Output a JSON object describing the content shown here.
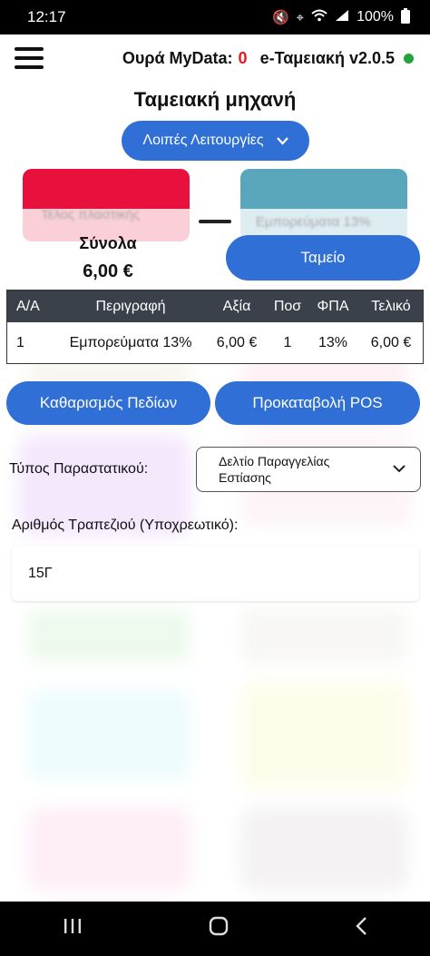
{
  "status": {
    "time": "12:17",
    "battery": "100%",
    "icons": [
      "mute-icon",
      "location-icon",
      "wifi-icon",
      "signal-icon",
      "battery-icon"
    ]
  },
  "header": {
    "queue_label": "Ουρά MyData:",
    "queue_count": "0",
    "app_name": "e-Ταμειακή v2.0.5",
    "online_color": "#22a33a"
  },
  "page": {
    "title": "Ταμειακή μηχανή",
    "other_functions": "Λοιπές Λειτουργίες"
  },
  "background_tiles": {
    "top_left": "Τέλος πλαστικής",
    "top_right": "Εμπορεύματα 13%"
  },
  "sheet": {
    "totals_label": "Σύνολα",
    "totals_value": "6,00 €",
    "cash_button": "Ταμείο",
    "table": {
      "headers": [
        "Α/Α",
        "Περιγραφή",
        "Αξία",
        "Ποσ",
        "ΦΠΑ",
        "Τελικό"
      ],
      "rows": [
        [
          "1",
          "Εμπορεύματα 13%",
          "6,00 €",
          "1",
          "13%",
          "6,00 €"
        ]
      ]
    },
    "clear_button": "Καθαρισμός Πεδίων",
    "pos_button": "Προκαταβολή POS",
    "doc_type_label": "Τύπος Παραστατικού:",
    "doc_type_value": "Δελτίο Παραγγελίας Εστίασης",
    "table_number_label": "Αριθμός Τραπεζιού (Υποχρεωτικό):",
    "table_number_value": "15Γ"
  },
  "colors": {
    "accent": "#2f6fd6",
    "queue_count": "#e21b1b",
    "table_header": "#3b414b"
  }
}
